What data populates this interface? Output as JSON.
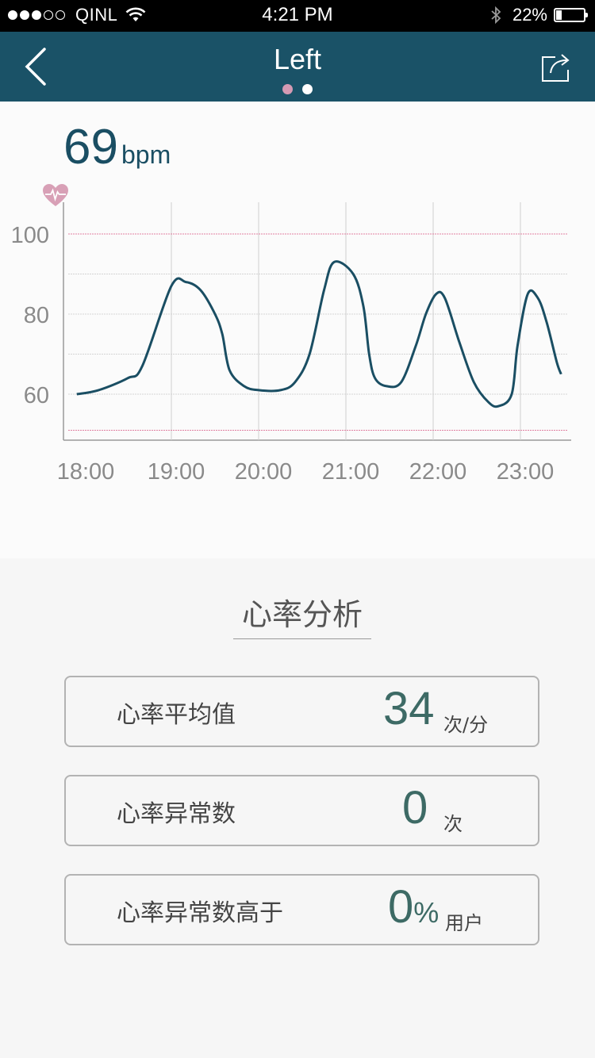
{
  "status_bar": {
    "signal_filled": 3,
    "signal_total": 5,
    "carrier": "QINL",
    "time": "4:21 PM",
    "battery": "22%",
    "battery_level": 0.22
  },
  "nav": {
    "title": "Left",
    "page_dots": [
      {
        "active": false,
        "color": "#d49ab3"
      },
      {
        "active": true,
        "color": "#ffffff"
      }
    ]
  },
  "heart_rate": {
    "value": "69",
    "unit": "bpm"
  },
  "chart_data": {
    "type": "line",
    "xlabel": "",
    "ylabel": "",
    "x_ticks": [
      "18:00",
      "19:00",
      "20:00",
      "21:00",
      "22:00",
      "23:00"
    ],
    "y_ticks": [
      "100",
      "80",
      "60"
    ],
    "reference_lines": [
      100,
      51
    ],
    "reference_color": "#e07fa0",
    "line_color": "#1a4e63",
    "grid": true,
    "series": [
      {
        "name": "",
        "points": [
          [
            "17:55",
            60
          ],
          [
            "18:10",
            61
          ],
          [
            "18:30",
            64
          ],
          [
            "18:40",
            67
          ],
          [
            "19:00",
            87
          ],
          [
            "19:10",
            88
          ],
          [
            "19:20",
            86
          ],
          [
            "19:30",
            80
          ],
          [
            "19:35",
            75
          ],
          [
            "19:40",
            66
          ],
          [
            "19:50",
            62
          ],
          [
            "20:00",
            61
          ],
          [
            "20:15",
            61
          ],
          [
            "20:25",
            63
          ],
          [
            "20:35",
            70
          ],
          [
            "20:45",
            86
          ],
          [
            "20:52",
            93
          ],
          [
            "21:05",
            90
          ],
          [
            "21:12",
            82
          ],
          [
            "21:16",
            70
          ],
          [
            "21:20",
            64
          ],
          [
            "21:28",
            62
          ],
          [
            "21:38",
            63
          ],
          [
            "21:48",
            72
          ],
          [
            "21:55",
            80
          ],
          [
            "22:02",
            85
          ],
          [
            "22:08",
            84
          ],
          [
            "22:18",
            73
          ],
          [
            "22:28",
            63
          ],
          [
            "22:38",
            58
          ],
          [
            "22:45",
            57
          ],
          [
            "22:54",
            60
          ],
          [
            "22:58",
            72
          ],
          [
            "23:05",
            85
          ],
          [
            "23:12",
            84
          ],
          [
            "23:18",
            78
          ],
          [
            "23:25",
            68
          ],
          [
            "23:28",
            65
          ]
        ]
      }
    ]
  },
  "analysis": {
    "title": "心率分析",
    "cards": [
      {
        "label": "心率平均值",
        "value": "34",
        "unit": "次/分"
      },
      {
        "label": "心率异常数",
        "value": "0",
        "unit": "次"
      },
      {
        "label": "心率异常数高于",
        "value": "0",
        "pct": "%",
        "unit": "用户"
      }
    ]
  },
  "icons": {
    "back": "chevron-left-icon",
    "share": "share-icon",
    "heart": "heart-pulse-icon",
    "wifi": "wifi-icon",
    "bluetooth": "bluetooth-icon",
    "battery": "battery-icon"
  }
}
